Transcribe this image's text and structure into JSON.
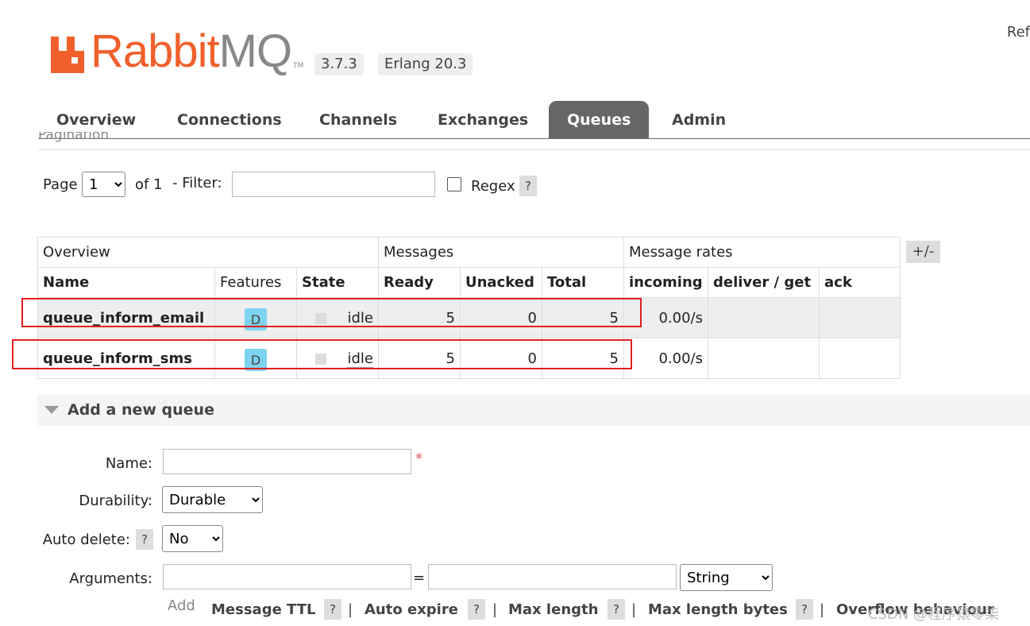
{
  "header": {
    "brand": "RabbitMQ",
    "brand_main": "Rabbit",
    "brand_mq": "MQ",
    "trademark": "TM",
    "version": "3.7.3",
    "erlang": "Erlang 20.3",
    "refresh_partial": "Ref"
  },
  "tabs": [
    {
      "label": "Overview"
    },
    {
      "label": "Connections"
    },
    {
      "label": "Channels"
    },
    {
      "label": "Exchanges"
    },
    {
      "label": "Queues"
    },
    {
      "label": "Admin"
    }
  ],
  "active_tab": "Queues",
  "pagination": {
    "section_title": "Pagination",
    "page_label": "Page",
    "page_value": "1",
    "of_label": "of 1",
    "filter_label": "- Filter:",
    "filter_value": "",
    "regex_label": "Regex",
    "help": "?"
  },
  "table": {
    "groups": [
      "Overview",
      "Messages",
      "Message rates"
    ],
    "columns": [
      "Name",
      "Features",
      "State",
      "Ready",
      "Unacked",
      "Total",
      "incoming",
      "deliver / get",
      "ack"
    ],
    "toggle": "+/-",
    "rows": [
      {
        "name": "queue_inform_email",
        "feature": "D",
        "state": "idle",
        "ready": "5",
        "unacked": "0",
        "total": "5",
        "incoming": "0.00/s",
        "deliver_get": "",
        "ack": ""
      },
      {
        "name": "queue_inform_sms",
        "feature": "D",
        "state": "idle",
        "ready": "5",
        "unacked": "0",
        "total": "5",
        "incoming": "0.00/s",
        "deliver_get": "",
        "ack": ""
      }
    ]
  },
  "add_queue": {
    "title": "Add a new queue",
    "name_label": "Name:",
    "name_value": "",
    "required_mark": "*",
    "durability_label": "Durability:",
    "durability_value": "Durable",
    "auto_delete_label": "Auto delete:",
    "auto_delete_value": "No",
    "arguments_label": "Arguments:",
    "equals": "=",
    "arg_type_value": "String",
    "add_label": "Add",
    "arg_links": [
      "Message TTL",
      "Auto expire",
      "Max length",
      "Max length bytes",
      "Overflow behaviour"
    ],
    "help": "?",
    "separator": "|"
  },
  "watermark": "CSDN @程序猿零柒"
}
